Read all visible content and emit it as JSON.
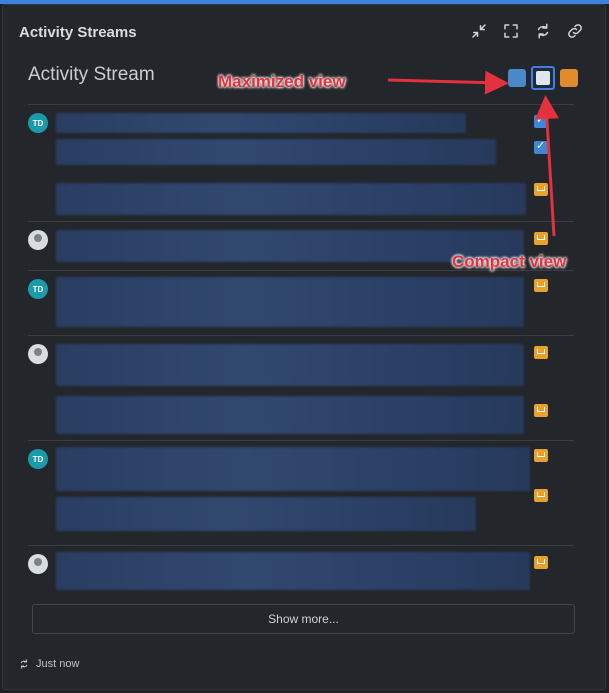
{
  "widget": {
    "title": "Activity Streams",
    "tools": [
      "compress-icon",
      "expand-icon",
      "refresh-icon",
      "link-icon"
    ]
  },
  "stream": {
    "title": "Activity Stream",
    "view_buttons": [
      "maximized-view-icon",
      "compact-view-icon",
      "rss-icon"
    ],
    "rows": [
      {
        "avatar": "TD"
      },
      {
        "avatar": ""
      },
      {
        "avatar": "TD"
      },
      {
        "avatar": ""
      },
      {
        "avatar": "TD"
      },
      {
        "avatar": ""
      }
    ]
  },
  "show_more": "Show more...",
  "footer": {
    "refresh_text": "Just now"
  },
  "annotations": {
    "maximized": "Maximized view",
    "compact": "Compact view"
  },
  "colors": {
    "accent": "#3f7fe0",
    "annotation": "#e3313d",
    "mail": "#e8a12f"
  }
}
